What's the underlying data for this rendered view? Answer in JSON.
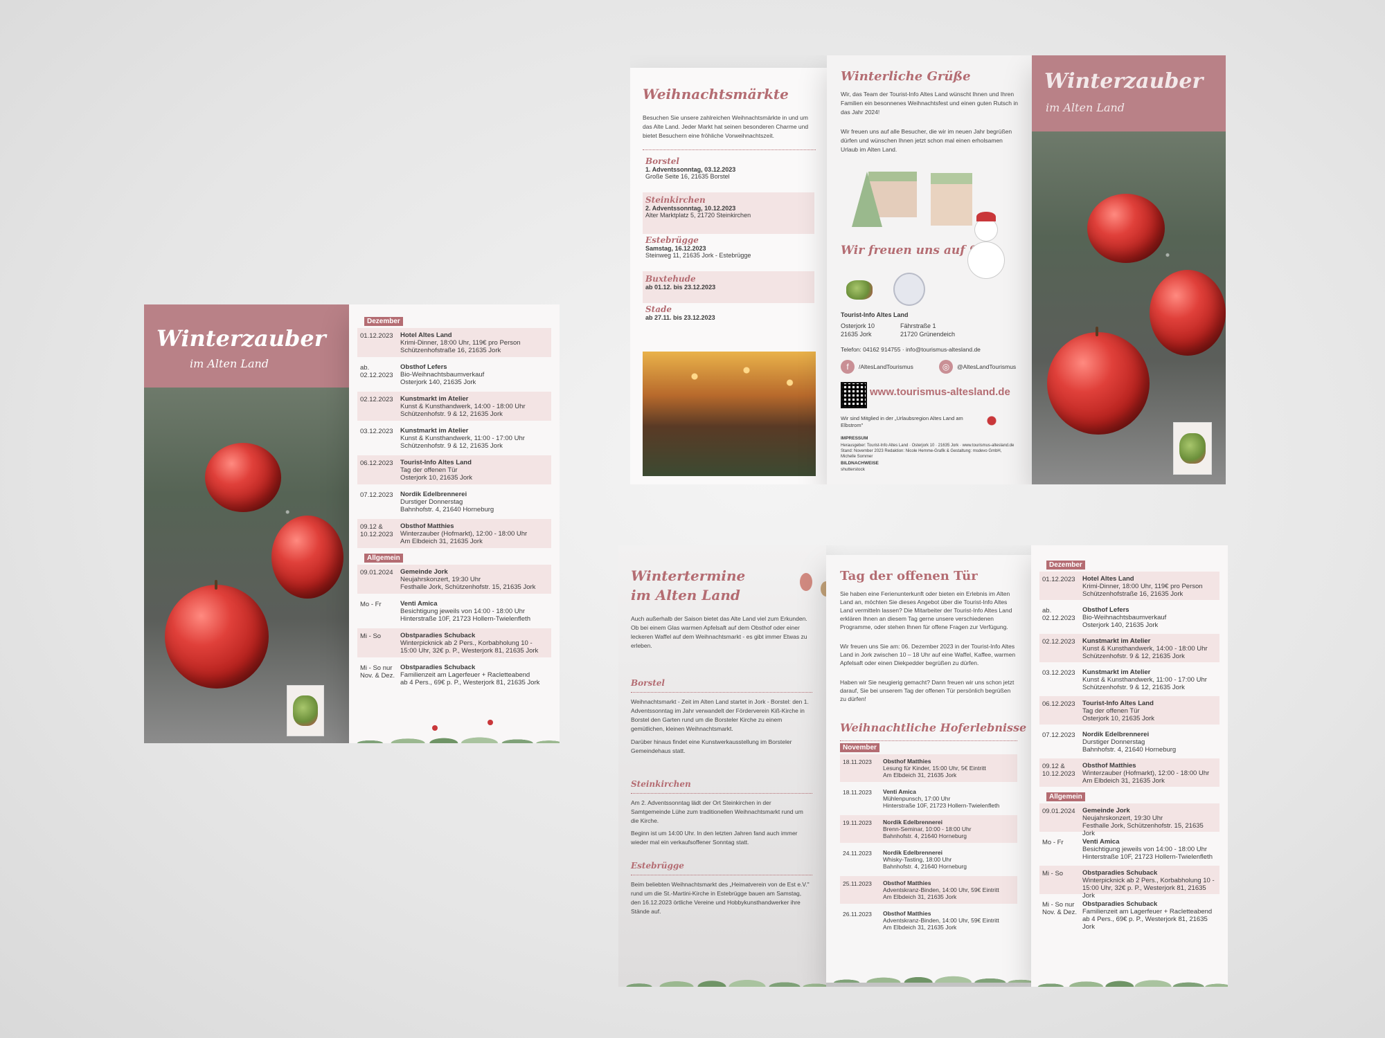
{
  "colors": {
    "accent": "#b46c72",
    "cover": "#b98187",
    "row_alt": "#f3e4e4"
  },
  "cover": {
    "title": "Winterzauber",
    "subtitle": "im Alten Land"
  },
  "events": {
    "dezember_label": "Dezember",
    "allgemein_label": "Allgemein",
    "dezember": [
      {
        "date": "01.12.2023",
        "name": "Hotel Altes Land",
        "l1": "Krimi-Dinner, 18:00 Uhr, 119€ pro Person",
        "l2": "Schützenhofstraße 16, 21635 Jork"
      },
      {
        "date": "ab. 02.12.2023",
        "name": "Obsthof Lefers",
        "l1": "Bio-Weihnachtsbaumverkauf",
        "l2": "Osterjork 140, 21635 Jork"
      },
      {
        "date": "02.12.2023",
        "name": "Kunstmarkt im Atelier",
        "l1": "Kunst & Kunsthandwerk, 14:00 - 18:00 Uhr",
        "l2": "Schützenhofstr. 9 & 12, 21635 Jork"
      },
      {
        "date": "03.12.2023",
        "name": "Kunstmarkt im Atelier",
        "l1": "Kunst & Kunsthandwerk, 11:00 - 17:00 Uhr",
        "l2": "Schützenhofstr. 9 & 12, 21635 Jork"
      },
      {
        "date": "06.12.2023",
        "name": "Tourist-Info Altes Land",
        "l1": "Tag der offenen Tür",
        "l2": "Osterjork 10, 21635 Jork"
      },
      {
        "date": "07.12.2023",
        "name": "Nordik Edelbrennerei",
        "l1": "Durstiger Donnerstag",
        "l2": "Bahnhofstr. 4, 21640 Horneburg"
      },
      {
        "date": "09.12 & 10.12.2023",
        "name": "Obsthof Matthies",
        "l1": "Winterzauber (Hofmarkt), 12:00 - 18:00 Uhr",
        "l2": "Am Elbdeich 31, 21635 Jork"
      }
    ],
    "allgemein": [
      {
        "date": "09.01.2024",
        "name": "Gemeinde Jork",
        "l1": "Neujahrskonzert, 19:30 Uhr",
        "l2": "Festhalle Jork, Schützenhofstr. 15, 21635 Jork"
      },
      {
        "date": "Mo - Fr",
        "name": "Venti Amica",
        "l1": "Besichtigung jeweils von 14:00 - 18:00 Uhr",
        "l2": "Hinterstraße 10F, 21723 Hollern-Twielenfleth"
      },
      {
        "date": "Mi - So",
        "name": "Obstparadies Schuback",
        "l1": "Winterpicknick ab 2 Pers., Korbabholung 10 - 15:00 Uhr, 32€ p. P., Westerjork 81, 21635 Jork",
        "l2": ""
      },
      {
        "date": "Mi - So nur Nov. & Dez.",
        "name": "Obstparadies Schuback",
        "l1": "Familienzeit am Lagerfeuer + Racletteabend",
        "l2": "ab 4 Pers., 69€ p. P., Westerjork 81, 21635 Jork"
      }
    ]
  },
  "markets": {
    "title": "Weihnachtsmärkte",
    "intro": "Besuchen Sie unsere zahlreichen Weihnachtsmärkte in und um das Alte Land. Jeder Markt hat seinen besonderen Charme und bietet Besuchern eine fröhliche Vorweihnachtszeit.",
    "items": [
      {
        "name": "Borstel",
        "date": "1. Adventssonntag, 03.12.2023",
        "addr": "Große Seite 16, 21635 Borstel"
      },
      {
        "name": "Steinkirchen",
        "date": "2. Adventssonntag, 10.12.2023",
        "addr": "Alter Marktplatz 5, 21720 Steinkirchen"
      },
      {
        "name": "Estebrügge",
        "date": "Samstag, 16.12.2023",
        "addr": "Steinweg 11, 21635 Jork - Estebrügge"
      },
      {
        "name": "Buxtehude",
        "date": "ab 01.12. bis 23.12.2023",
        "addr": ""
      },
      {
        "name": "Stade",
        "date": "ab 27.11. bis 23.12.2023",
        "addr": ""
      }
    ]
  },
  "greetings": {
    "title": "Winterliche Grüße",
    "p1": "Wir, das Team der Tourist-Info Altes Land wünscht Ihnen und Ihren Familien ein besonnenes Weihnachtsfest und einen guten Rutsch in das Jahr 2024!",
    "p2": "Wir freuen uns auf alle Besucher, die wir im neuen Jahr begrüßen dürfen und wünschen Ihnen jetzt schon mal einen erholsamen Urlaub im Alten Land.",
    "slogan": "Wir freuen uns auf Sie!",
    "org": "Tourist-Info Altes Land",
    "addr1a": "Osterjork 10",
    "addr1b": "21635 Jork",
    "addr2a": "Fährstraße 1",
    "addr2b": "21720 Grünendeich",
    "phone": "Telefon: 04162 914755 · info@tourismus-altesland.de",
    "facebook": "/AltesLandTourismus",
    "instagram": "@AltesLandTourismus",
    "website": "www.tourismus-altesland.de",
    "member": "Wir sind Mitglied in der „Urlaubsregion Altes Land am Elbstrom\"",
    "impressum_label": "IMPRESSUM",
    "impressum": "Herausgeber: Tourist-Info Altes Land · Osterjork 10 · 21635 Jork · www.tourismus-altesland.de Stand: November 2023 Redaktion: Nicole Hemme-Grafik & Gestaltung: msdevo GmbH, Michelle Sommer",
    "bild_label": "BILDNACHWEISE",
    "bild": "shutterstock"
  },
  "winter": {
    "title": "Wintertermine im Alten Land",
    "intro": "Auch außerhalb der Saison bietet das Alte Land viel zum Erkunden. Ob bei einem Glas warmen Apfelsaft auf dem Obsthof oder einer leckeren Waffel auf dem Weihnachtsmarkt - es gibt immer Etwas zu erleben.",
    "s1_title": "Borstel",
    "s1_text": "Weihnachtsmarkt - Zeit im Alten Land startet in Jork - Borstel: den 1. Adventssonntag im Jahr verwandelt der Förderverein Kiß-Kirche in Borstel den Garten rund um die Borsteler Kirche zu einem gemütlichen, kleinen Weihnachtsmarkt.",
    "s1_text2": "Darüber hinaus findet eine Kunstwerkausstellung im Borsteler Gemeindehaus statt.",
    "s2_title": "Steinkirchen",
    "s2_text": "Am 2. Adventssonntag lädt der Ort Steinkirchen in der Samtgemeinde Lühe zum traditionellen Weihnachtsmarkt rund um die Kirche.",
    "s2_text2": "Beginn ist um 14:00 Uhr. In den letzten Jahren fand auch immer wieder mal ein verkaufsoffener Sonntag statt.",
    "s3_title": "Estebrügge",
    "s3_text": "Beim beliebten Weihnachtsmarkt des „Heimatverein von de Est e.V.\" rund um die St.-Martini-Kirche in Estebrügge bauen am Samstag, den 16.12.2023 örtliche Vereine und Hobbykunsthandwerker ihre Stände auf."
  },
  "openday": {
    "title": "Tag der offenen Tür",
    "p1": "Sie haben eine Ferienunterkunft oder bieten ein Erlebnis im Alten Land an, möchten Sie dieses Angebot über die Tourist-Info Altes Land vermitteln lassen? Die Mitarbeiter der Tourist-Info Altes Land erklären Ihnen an diesem Tag gerne unsere verschiedenen Programme, oder stehen Ihnen für offene Fragen zur Verfügung.",
    "p2": "Wir freuen uns Sie am: 06. Dezember 2023 in der Tourist-Info Altes Land in Jork zwischen 10 – 18 Uhr auf eine Waffel, Kaffee, warmen Apfelsaft oder einen Diekpedder begrüßen zu dürfen.",
    "p3": "Haben wir Sie neugierig gemacht? Dann freuen wir uns schon jetzt darauf, Sie bei unserem Tag der offenen Tür persönlich begrüßen zu dürfen!"
  },
  "farms": {
    "title": "Weihnachtliche Hoferlebnisse",
    "month": "November",
    "items": [
      {
        "date": "18.11.2023",
        "name": "Obsthof Matthies",
        "l1": "Lesung für Kinder, 15:00 Uhr, 5€ Eintritt",
        "l2": "Am Elbdeich 31, 21635 Jork"
      },
      {
        "date": "18.11.2023",
        "name": "Venti Amica",
        "l1": "Mühlenpunsch, 17:00 Uhr",
        "l2": "Hinterstraße 10F, 21723 Hollern-Twielenfleth"
      },
      {
        "date": "19.11.2023",
        "name": "Nordik Edelbrennerei",
        "l1": "Brenn-Seminar, 10:00 - 18:00 Uhr",
        "l2": "Bahnhofstr. 4, 21640 Horneburg"
      },
      {
        "date": "24.11.2023",
        "name": "Nordik Edelbrennerei",
        "l1": "Whisky-Tasting, 18:00 Uhr",
        "l2": "Bahnhofstr. 4, 21640 Horneburg"
      },
      {
        "date": "25.11.2023",
        "name": "Obsthof Matthies",
        "l1": "Adventskranz-Binden, 14:00 Uhr, 59€ Eintritt",
        "l2": "Am Elbdeich 31, 21635 Jork"
      },
      {
        "date": "26.11.2023",
        "name": "Obsthof Matthies",
        "l1": "Adventskranz-Binden, 14:00 Uhr, 59€ Eintritt",
        "l2": "Am Elbdeich 31, 21635 Jork"
      }
    ]
  }
}
